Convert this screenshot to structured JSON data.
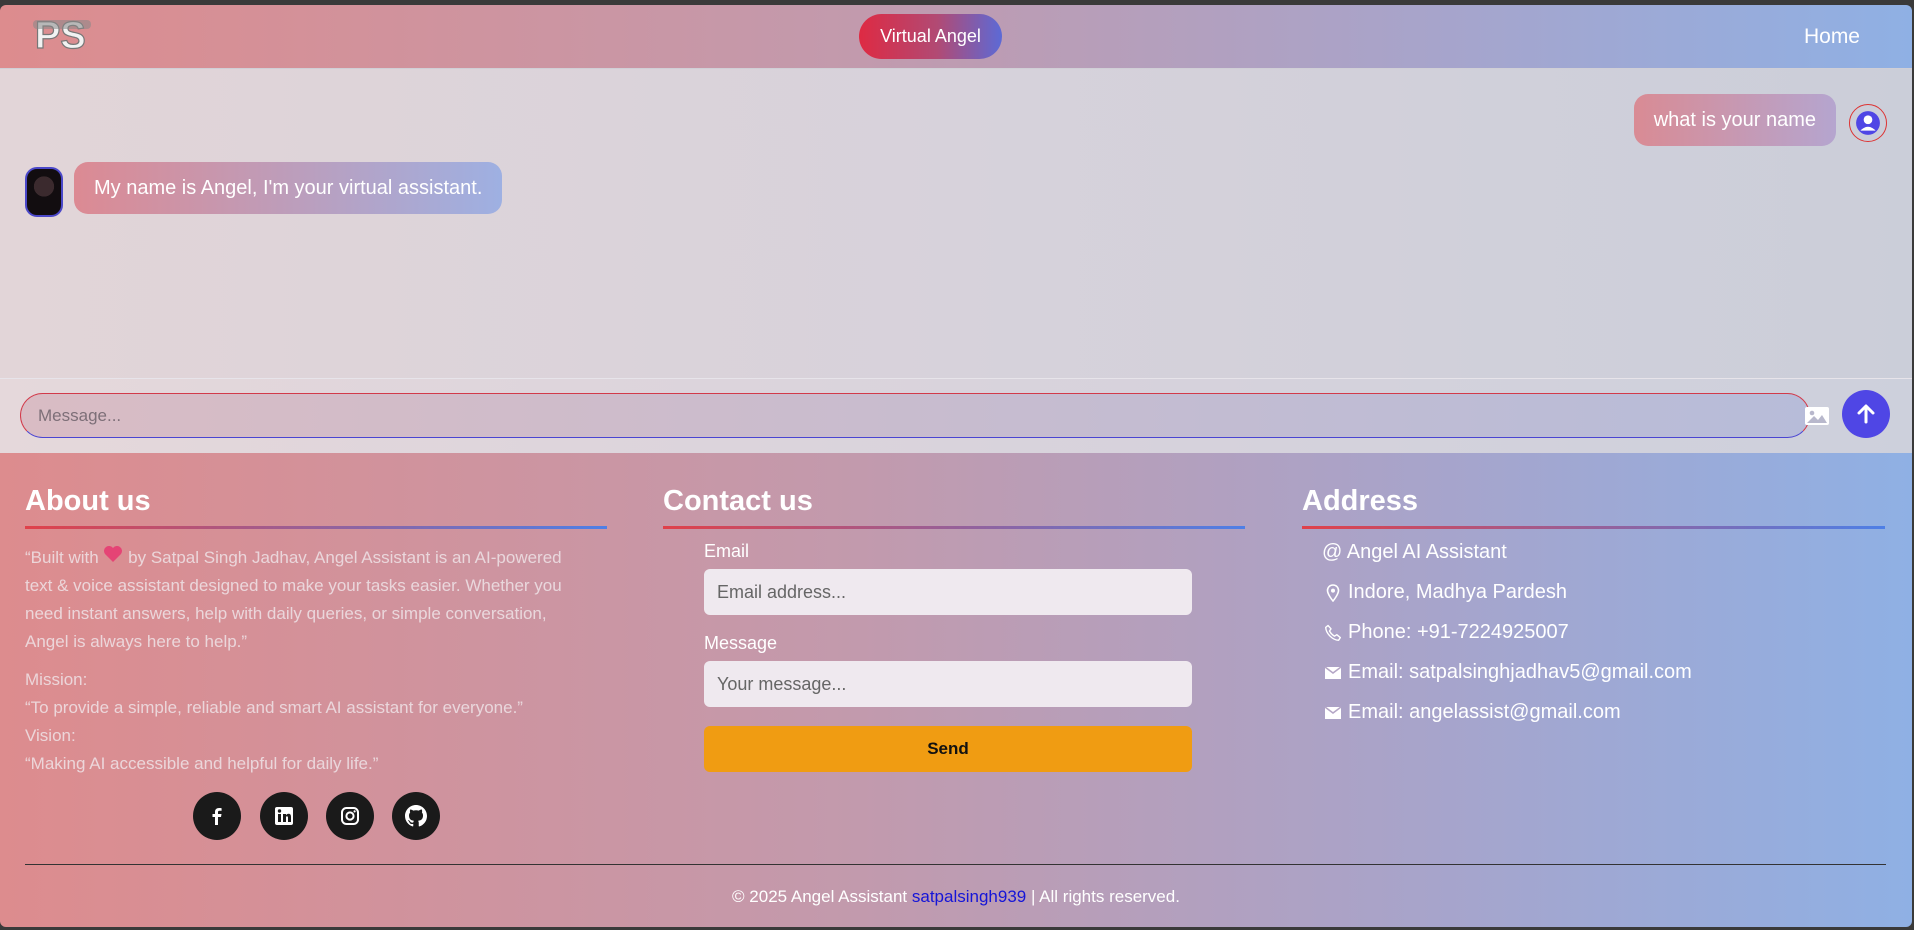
{
  "header": {
    "logo_text": "PS",
    "brand_label": "Virtual Angel",
    "home_label": "Home"
  },
  "chat": {
    "messages": [
      {
        "role": "user",
        "text": "what is your name"
      },
      {
        "role": "bot",
        "text": "My name is Angel, I'm your virtual assistant."
      }
    ],
    "input_placeholder": "Message..."
  },
  "footer": {
    "about": {
      "title": "About us",
      "text_before_heart": "“Built with",
      "heart_icon": "heart-icon",
      "text_after_heart": "by Satpal Singh Jadhav, Angel Assistant is an AI-powered text & voice assistant designed to make your tasks easier. Whether you need instant answers, help with daily queries, or simple conversation, Angel is always here to help.”",
      "mission_label": "Mission:",
      "mission_text": "“To provide a simple, reliable and smart AI assistant for everyone.”",
      "vision_label": "Vision:",
      "vision_text": "“Making AI accessible and helpful for daily life.”",
      "social": [
        "facebook-icon",
        "linkedin-icon",
        "instagram-icon",
        "github-icon"
      ]
    },
    "contact": {
      "title": "Contact us",
      "email_label": "Email",
      "email_placeholder": "Email address...",
      "message_label": "Message",
      "message_placeholder": "Your message...",
      "send_label": "Send"
    },
    "address": {
      "title": "Address",
      "rows": [
        {
          "icon": "at-icon",
          "text": "@ Angel AI Assistant"
        },
        {
          "icon": "location-pin-icon",
          "text": "Indore, Madhya Pardesh"
        },
        {
          "icon": "phone-icon",
          "text": "Phone: +91-7224925007"
        },
        {
          "icon": "mail-icon",
          "text": "Email: satpalsinghjadhav5@gmail.com"
        },
        {
          "icon": "mail-icon",
          "text": "Email: angelassist@gmail.com"
        }
      ]
    },
    "copyright_prefix": "© 2025 Angel Assistant",
    "copyright_handle": "satpalsingh939",
    "copyright_suffix": "| All rights reserved."
  },
  "colors": {
    "accent": "#4f46e5",
    "brand_red": "#de2a43",
    "send_orange": "#f09c12"
  }
}
